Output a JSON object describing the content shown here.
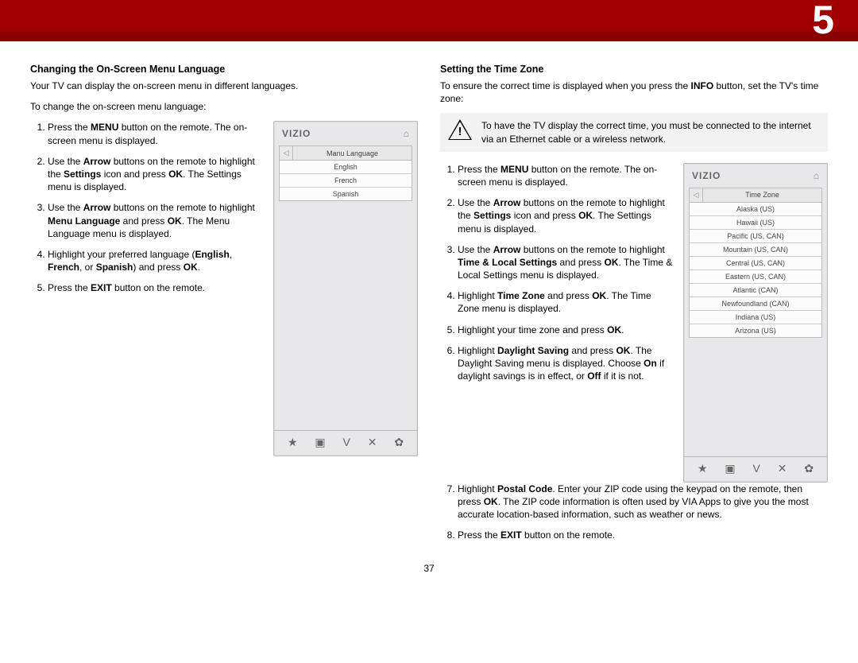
{
  "chapter": "5",
  "pageNumber": "37",
  "left": {
    "title": "Changing the On-Screen Menu Language",
    "intro1": "Your TV can display the on-screen menu in different languages.",
    "intro2": "To change the on-screen menu language:",
    "steps": [
      "Press the <b>MENU</b> button on the remote. The on-screen menu is displayed.",
      "Use the <b>Arrow</b> buttons on the remote to highlight the <b>Settings</b> icon and press <b>OK</b>. The Settings menu is displayed.",
      "Use the <b>Arrow</b> buttons on the remote to highlight <b>Menu Language</b> and press <b>OK</b>. The Menu Language menu is displayed.",
      "Highlight your preferred language (<b>English</b>, <b>French</b>, or <b>Spanish</b>) and press <b>OK</b>.",
      "Press the <b>EXIT</b> button on the remote."
    ],
    "tv": {
      "brand": "VIZIO",
      "title": "Manu Language",
      "items": [
        "English",
        "French",
        "Spanish"
      ]
    }
  },
  "right": {
    "title": "Setting the Time Zone",
    "intro": "To ensure the correct time is displayed when you press the <b>INFO</b> button, set the TV's time zone:",
    "notice": "To have the TV display the correct time, you must be connected to the internet via an Ethernet cable or a wireless network.",
    "stepsNarrow": [
      "Press the <b>MENU</b> button on the remote. The on-screen menu is displayed.",
      "Use the <b>Arrow</b> buttons on the remote to highlight the <b>Settings</b> icon and press <b>OK</b>. The Settings menu is displayed.",
      "Use the <b>Arrow</b> buttons on the remote to highlight <b>Time & Local Settings</b> and press <b>OK</b>. The Time & Local Settings menu is displayed.",
      "Highlight <b>Time Zone</b> and press <b>OK</b>. The Time Zone menu is displayed.",
      "Highlight your time zone and press <b>OK</b>.",
      "Highlight <b>Daylight Saving</b> and press <b>OK</b>. The Daylight Saving menu is displayed. Choose <b>On</b> if daylight savings is in effect, or <b>Off</b> if it is not."
    ],
    "stepsWide": [
      "Highlight <b>Postal Code</b>. Enter your ZIP code using the keypad on the remote, then press <b>OK</b>. The ZIP code information is often used by VIA Apps to give you the most accurate location-based information, such as weather or news.",
      "Press the <b>EXIT</b> button on the remote."
    ],
    "tv": {
      "brand": "VIZIO",
      "title": "Time Zone",
      "items": [
        "Alaska (US)",
        "Hawaii (US)",
        "Pacific (US, CAN)",
        "Mountain (US, CAN)",
        "Central (US, CAN)",
        "Eastern (US, CAN)",
        "Atlantic (CAN)",
        "Newfoundland (CAN)",
        "Indiana (US)",
        "Arizona (US)"
      ]
    }
  },
  "footIcons": [
    "★",
    "▣",
    "V",
    "✕",
    "✿"
  ]
}
